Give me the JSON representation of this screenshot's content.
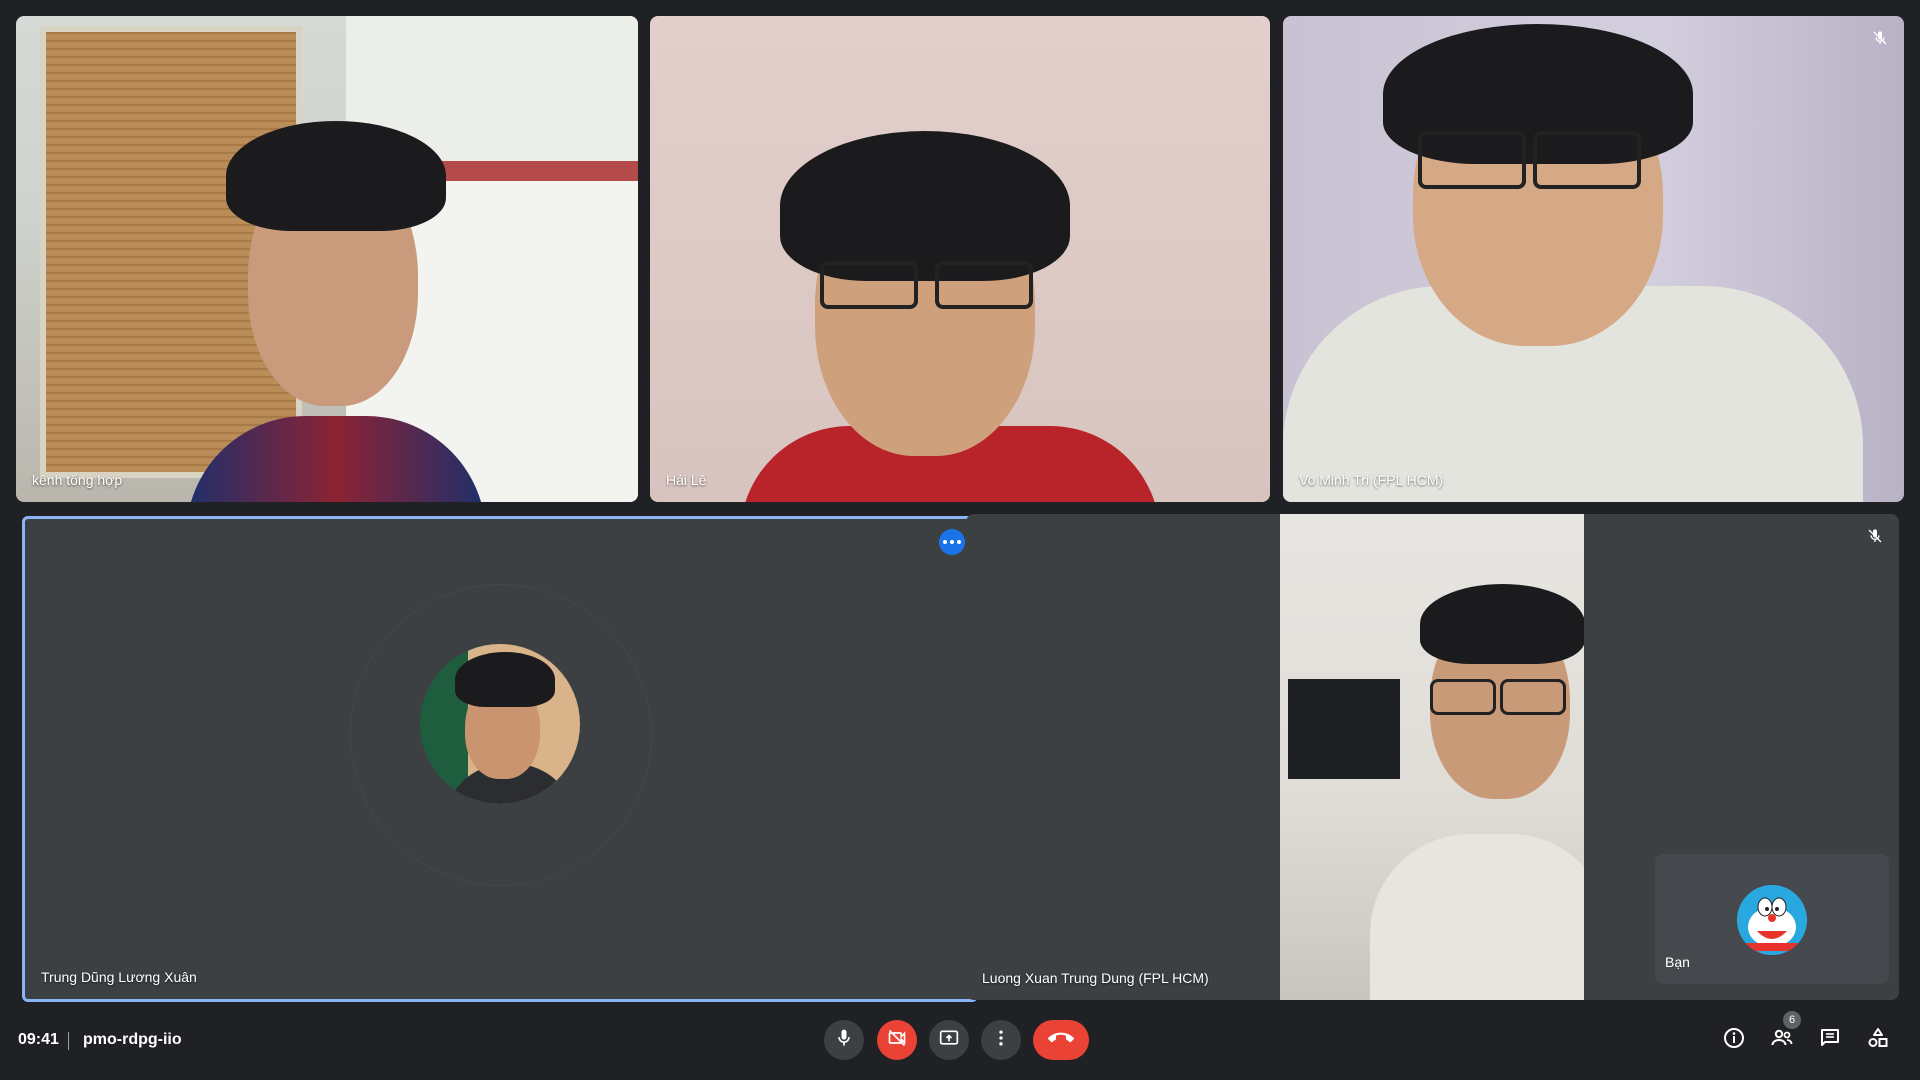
{
  "participants": [
    {
      "name": "kênh tổng hợp"
    },
    {
      "name": "Hải Lê"
    },
    {
      "name": "Vo Minh Tri (FPL HCM)"
    },
    {
      "name": "Trung Dũng Lương Xuân"
    },
    {
      "name": "Luong Xuan Trung Dung (FPL HCM)"
    }
  ],
  "self": {
    "name": "Bạn"
  },
  "meeting": {
    "time": "09:41",
    "code": "pmo-rdpg-iio"
  },
  "people_count": "6",
  "colors": {
    "background": "#202124",
    "tile": "#3c4043",
    "accent": "#1a73e8",
    "danger": "#ea4335",
    "speaking_border": "#8ab4f8"
  },
  "icons": {
    "controls": [
      "mic-icon",
      "camera-off-icon",
      "present-screen-icon",
      "more-options-icon",
      "leave-call-icon"
    ],
    "right": [
      "meeting-info-icon",
      "people-icon",
      "chat-icon",
      "activities-icon"
    ]
  }
}
